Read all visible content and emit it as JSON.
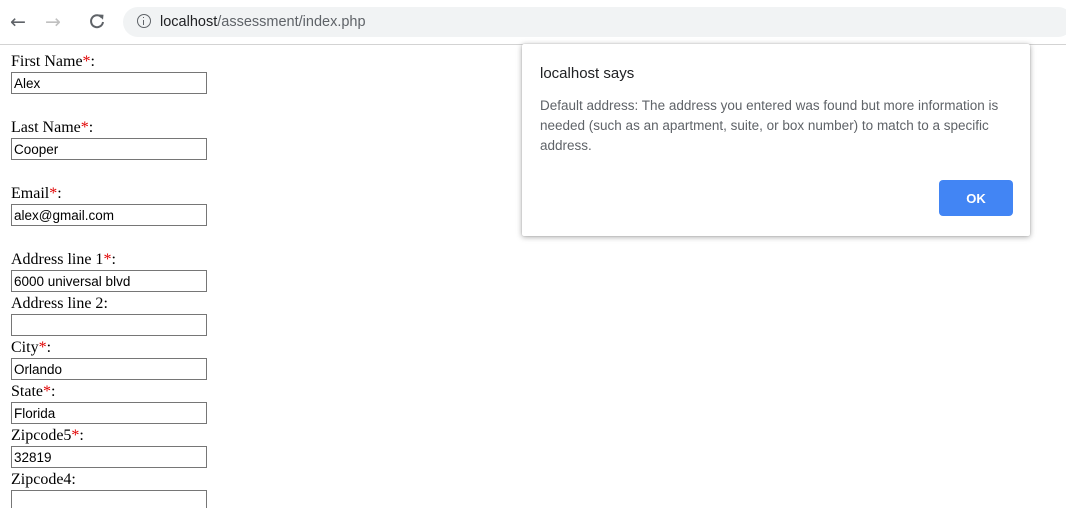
{
  "browser": {
    "back_icon": "←",
    "forward_icon": "→",
    "reload_icon": "C",
    "url_host": "localhost",
    "url_path": "/assessment/index.php"
  },
  "form": {
    "fields": [
      {
        "label": "First Name",
        "required": true,
        "value": "Alex"
      },
      {
        "label": "Last Name",
        "required": true,
        "value": "Cooper"
      },
      {
        "label": "Email",
        "required": true,
        "value": "alex@gmail.com"
      },
      {
        "label": "Address line 1",
        "required": true,
        "value": "6000 universal blvd"
      },
      {
        "label": "Address line 2",
        "required": false,
        "value": ""
      },
      {
        "label": "City",
        "required": true,
        "value": "Orlando"
      },
      {
        "label": "State",
        "required": true,
        "value": "Florida"
      },
      {
        "label": "Zipcode5",
        "required": true,
        "value": "32819"
      },
      {
        "label": "Zipcode4",
        "required": false,
        "value": ""
      }
    ],
    "required_mark": "*",
    "label_suffix": ":"
  },
  "dialog": {
    "title": "localhost says",
    "message": "Default address: The address you entered was found but more information is needed (such as an apartment, suite, or box number) to match to a specific address.",
    "ok_label": "OK"
  },
  "colors": {
    "required": "#e00000",
    "ok_button": "#4285f4"
  }
}
